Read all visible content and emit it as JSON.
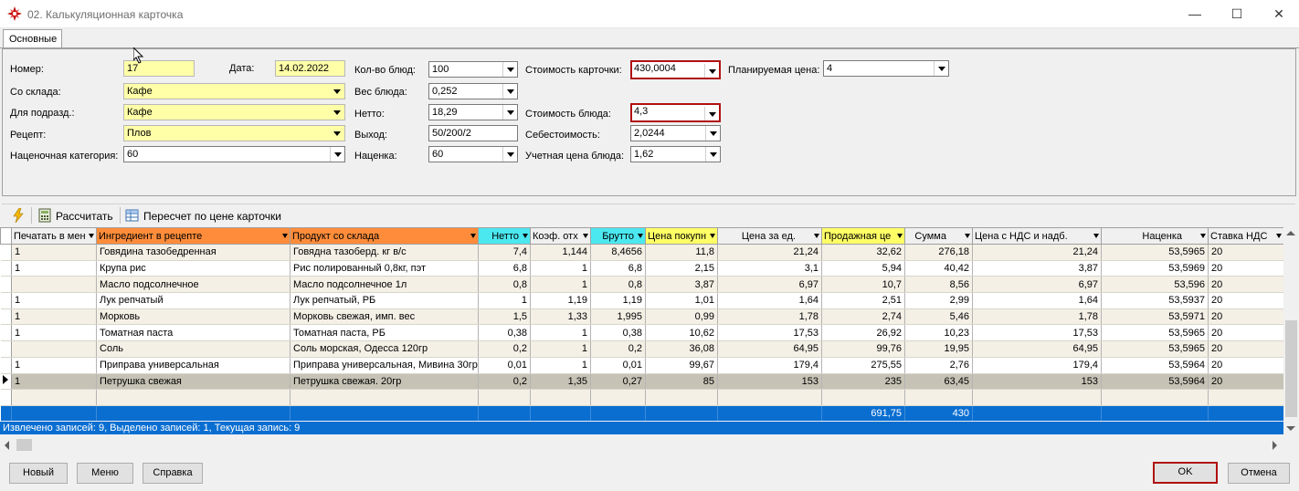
{
  "window": {
    "title": "02. Калькуляционная карточка"
  },
  "tabs": [
    "Основные"
  ],
  "form": {
    "nomer_label": "Номер:",
    "nomer_value": "17",
    "data_label": "Дата:",
    "data_value": "14.02.2022",
    "sklad_label": "Со склада:",
    "sklad_value": "Кафе",
    "podrazd_label": "Для подразд.:",
    "podrazd_value": "Кафе",
    "recept_label": "Рецепт:",
    "recept_value": "Плов",
    "nacen_kat_label": "Наценочная категория:",
    "nacen_kat_value": "60",
    "kol_label": "Кол-во блюд:",
    "kol_value": "100",
    "ves_label": "Вес блюда:",
    "ves_value": "0,252",
    "netto_label": "Нетто:",
    "netto_value": "18,29",
    "vyhod_label": "Выход:",
    "vyhod_value": "50/200/2",
    "nacenka_label": "Наценка:",
    "nacenka_value": "60",
    "stoim_kart_label": "Стоимость карточки:",
    "stoim_kart_value": "430,0004",
    "stoim_blyuda_label": "Стоимость блюда:",
    "stoim_blyuda_value": "4,3",
    "sebest_label": "Себестоимость:",
    "sebest_value": "2,0244",
    "uchet_label": "Учетная цена блюда:",
    "uchet_value": "1,62",
    "plan_label": "Планируемая цена:",
    "plan_value": "4"
  },
  "toolbar": {
    "calc_label": "Рассчитать",
    "recalc_label": "Пересчет по цене карточки"
  },
  "grid": {
    "columns": [
      "Печатать в мен",
      "Ингредиент в рецепте",
      "Продукт со склада",
      "Нетто",
      "Коэф. отх",
      "Брутто",
      "Цена покупн",
      "Цена за ед.",
      "Продажная це",
      "Сумма",
      "Цена с НДС и надб.",
      "Наценка",
      "Ставка НДС"
    ],
    "rows": [
      [
        "1",
        "Говядина тазобедренная",
        "Говядна тазоберд. кг в/с",
        "7,4",
        "1,144",
        "8,4656",
        "11,8",
        "21,24",
        "32,62",
        "276,18",
        "21,24",
        "53,5965",
        "20"
      ],
      [
        "1",
        "Крупа рис",
        "Рис полированный 0,8кг, пэт",
        "6,8",
        "1",
        "6,8",
        "2,15",
        "3,1",
        "5,94",
        "40,42",
        "3,87",
        "53,5969",
        "20"
      ],
      [
        "",
        "Масло подсолнечное",
        "Масло подсолнечное 1л",
        "0,8",
        "1",
        "0,8",
        "3,87",
        "6,97",
        "10,7",
        "8,56",
        "6,97",
        "53,596",
        "20"
      ],
      [
        "1",
        "Лук репчатый",
        "Лук репчатый, РБ",
        "1",
        "1,19",
        "1,19",
        "1,01",
        "1,64",
        "2,51",
        "2,99",
        "1,64",
        "53,5937",
        "20"
      ],
      [
        "1",
        "Морковь",
        "Морковь свежая, имп. вес",
        "1,5",
        "1,33",
        "1,995",
        "0,99",
        "1,78",
        "2,74",
        "5,46",
        "1,78",
        "53,5971",
        "20"
      ],
      [
        "1",
        "Томатная паста",
        "Томатная паста, РБ",
        "0,38",
        "1",
        "0,38",
        "10,62",
        "17,53",
        "26,92",
        "10,23",
        "17,53",
        "53,5965",
        "20"
      ],
      [
        "",
        "Соль",
        "Соль морская, Одесса 120гр",
        "0,2",
        "1",
        "0,2",
        "36,08",
        "64,95",
        "99,76",
        "19,95",
        "64,95",
        "53,5965",
        "20"
      ],
      [
        "1",
        "Приправа универсальная",
        "Приправа универсальная, Мивина 30гр",
        "0,01",
        "1",
        "0,01",
        "99,67",
        "179,4",
        "275,55",
        "2,76",
        "179,4",
        "53,5964",
        "20"
      ],
      [
        "1",
        "Петрушка свежая",
        "Петрушка свежая. 20гр",
        "0,2",
        "1,35",
        "0,27",
        "85",
        "153",
        "235",
        "63,45",
        "153",
        "53,5964",
        "20"
      ]
    ],
    "totals": {
      "prodazhnaya": "691,75",
      "summa": "430"
    }
  },
  "status": "Извлечено записей: 9, Выделено записей: 1, Текущая запись: 9",
  "buttons": {
    "new": "Новый",
    "menu": "Меню",
    "help": "Справка",
    "ok": "OK",
    "cancel": "Отмена"
  },
  "colors": {
    "yellow_field": "#ffffa8",
    "orange_header": "#ff8c3a",
    "cyan_header": "#4ce8f0",
    "yellow_header": "#ffff66",
    "totals_blue": "#0a6ed1",
    "highlight_red": "#b01010"
  }
}
